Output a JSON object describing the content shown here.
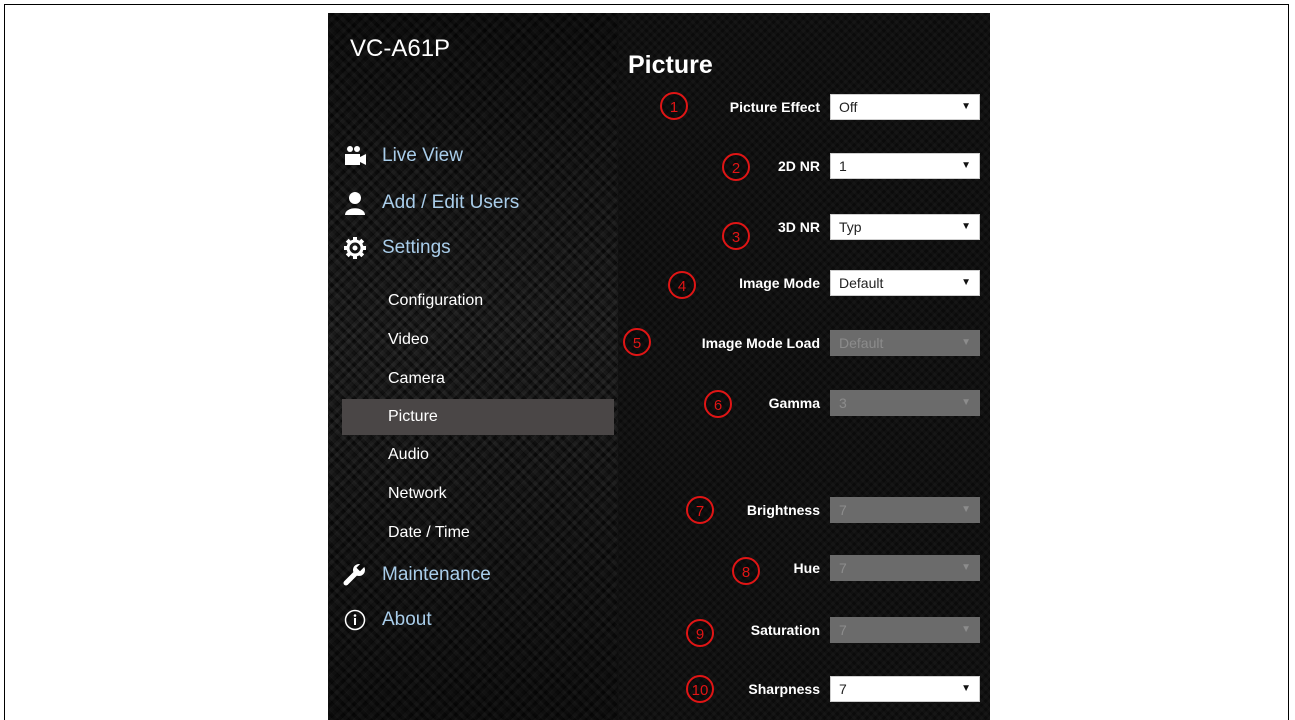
{
  "app_title": "VC-A61P",
  "page_title": "Picture",
  "main_nav": [
    {
      "label": "Live View",
      "icon": "video-camera-icon"
    },
    {
      "label": "Add / Edit Users",
      "icon": "user-icon"
    },
    {
      "label": "Settings",
      "icon": "gear-icon"
    },
    {
      "label": "Maintenance",
      "icon": "wrench-icon"
    },
    {
      "label": "About",
      "icon": "info-icon"
    }
  ],
  "settings_subnav": [
    {
      "label": "Configuration"
    },
    {
      "label": "Video"
    },
    {
      "label": "Camera"
    },
    {
      "label": "Picture",
      "active": true
    },
    {
      "label": "Audio"
    },
    {
      "label": "Network"
    },
    {
      "label": "Date / Time"
    }
  ],
  "fields": [
    {
      "num": "1",
      "label": "Picture Effect",
      "value": "Off",
      "enabled": true
    },
    {
      "num": "2",
      "label": "2D NR",
      "value": "1",
      "enabled": true
    },
    {
      "num": "3",
      "label": "3D NR",
      "value": "Typ",
      "enabled": true
    },
    {
      "num": "4",
      "label": "Image Mode",
      "value": "Default",
      "enabled": true
    },
    {
      "num": "5",
      "label": "Image Mode Load",
      "value": "Default",
      "enabled": false
    },
    {
      "num": "6",
      "label": "Gamma",
      "value": "3",
      "enabled": false
    },
    {
      "num": "7",
      "label": "Brightness",
      "value": "7",
      "enabled": false
    },
    {
      "num": "8",
      "label": "Hue",
      "value": "7",
      "enabled": false
    },
    {
      "num": "9",
      "label": "Saturation",
      "value": "7",
      "enabled": false
    },
    {
      "num": "10",
      "label": "Sharpness",
      "value": "7",
      "enabled": true
    }
  ],
  "colors": {
    "background": "#0b0b0b",
    "nav_link": "#a9cdea",
    "active_item": "#4a4646",
    "callout": "#e01515",
    "disabled_select": "#6b6b6b"
  }
}
